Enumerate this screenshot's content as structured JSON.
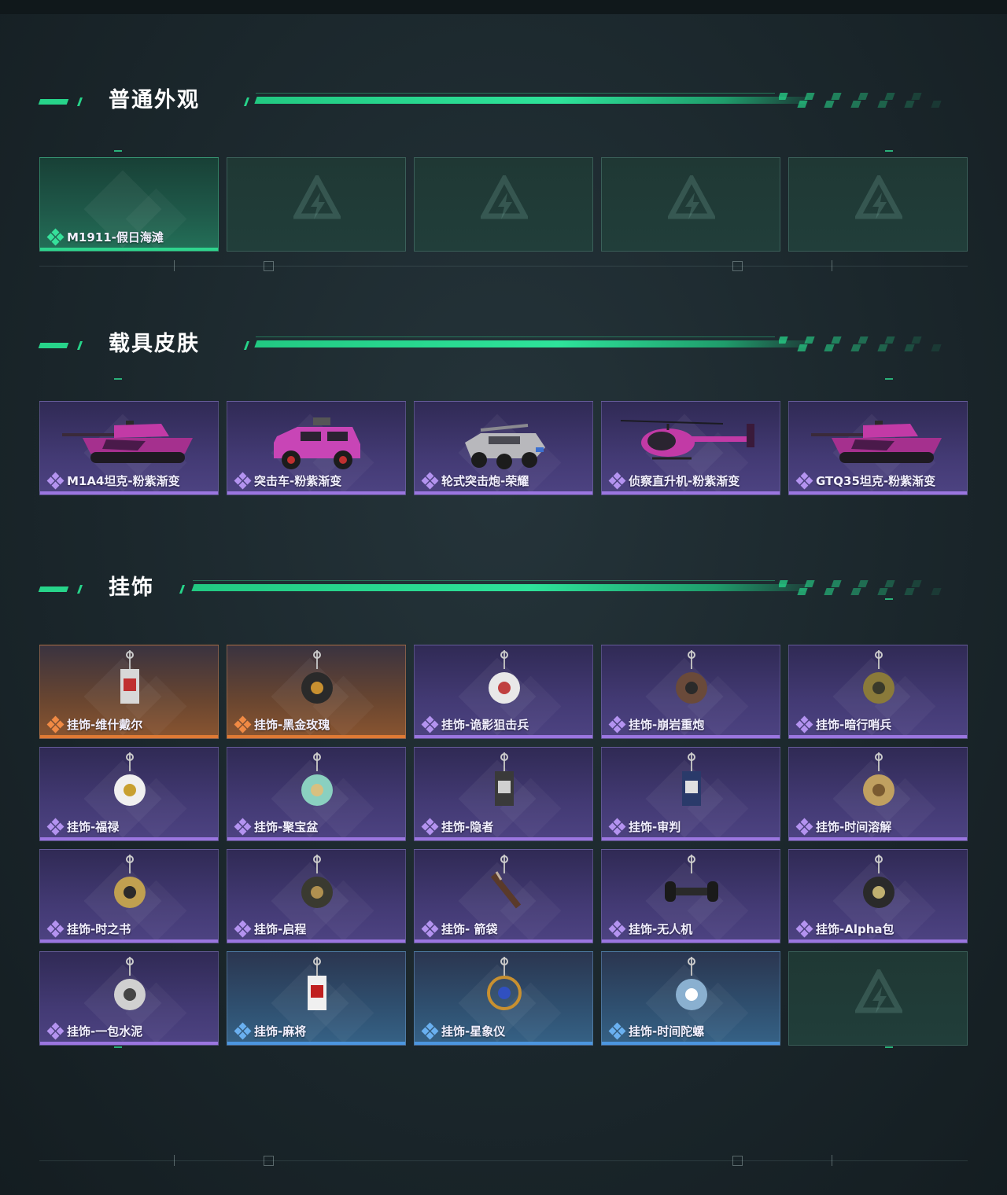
{
  "sections": [
    {
      "title": "普通外观"
    },
    {
      "title": "载具皮肤"
    },
    {
      "title": "挂饰"
    }
  ],
  "normal": [
    {
      "label": "M1911-假日海滩",
      "rarity": "green",
      "icon": "weapon-skin"
    },
    {
      "label": "",
      "rarity": "empty"
    },
    {
      "label": "",
      "rarity": "empty"
    },
    {
      "label": "",
      "rarity": "empty"
    },
    {
      "label": "",
      "rarity": "empty"
    }
  ],
  "vehicles": [
    {
      "label": "M1A4坦克-粉紫渐变",
      "rarity": "purple",
      "icon": "tank-icon"
    },
    {
      "label": "突击车-粉紫渐变",
      "rarity": "purple",
      "icon": "assault-vehicle-icon"
    },
    {
      "label": "轮式突击炮-荣耀",
      "rarity": "purple",
      "icon": "wheeled-gun-icon"
    },
    {
      "label": "侦察直升机-粉紫渐变",
      "rarity": "purple",
      "icon": "helicopter-icon"
    },
    {
      "label": "GTQ35坦克-粉紫渐变",
      "rarity": "purple",
      "icon": "tank-icon"
    }
  ],
  "charms": [
    {
      "label": "挂饰-维什戴尔",
      "rarity": "orange"
    },
    {
      "label": "挂饰-黑金玫瑰",
      "rarity": "orange"
    },
    {
      "label": "挂饰-诡影狙击兵",
      "rarity": "purple"
    },
    {
      "label": "挂饰-崩岩重炮",
      "rarity": "purple"
    },
    {
      "label": "挂饰-暗行哨兵",
      "rarity": "purple"
    },
    {
      "label": "挂饰-福禄",
      "rarity": "purple"
    },
    {
      "label": "挂饰-聚宝盆",
      "rarity": "purple"
    },
    {
      "label": "挂饰-隐者",
      "rarity": "purple"
    },
    {
      "label": "挂饰-审判",
      "rarity": "purple"
    },
    {
      "label": "挂饰-时间溶解",
      "rarity": "purple"
    },
    {
      "label": "挂饰-时之书",
      "rarity": "purple"
    },
    {
      "label": "挂饰-启程",
      "rarity": "purple"
    },
    {
      "label": "挂饰- 箭袋",
      "rarity": "purple"
    },
    {
      "label": "挂饰-无人机",
      "rarity": "purple"
    },
    {
      "label": "挂饰-Alpha包",
      "rarity": "purple"
    },
    {
      "label": "挂饰-一包水泥",
      "rarity": "purple"
    },
    {
      "label": "挂饰-麻将",
      "rarity": "blue"
    },
    {
      "label": "挂饰-星象仪",
      "rarity": "blue"
    },
    {
      "label": "挂饰-时间陀螺",
      "rarity": "blue"
    },
    {
      "label": "",
      "rarity": "empty"
    }
  ],
  "colors": {
    "accent": "#27d48a",
    "purple": "#9b76e0",
    "orange": "#e07a34",
    "blue": "#4c96e0"
  }
}
